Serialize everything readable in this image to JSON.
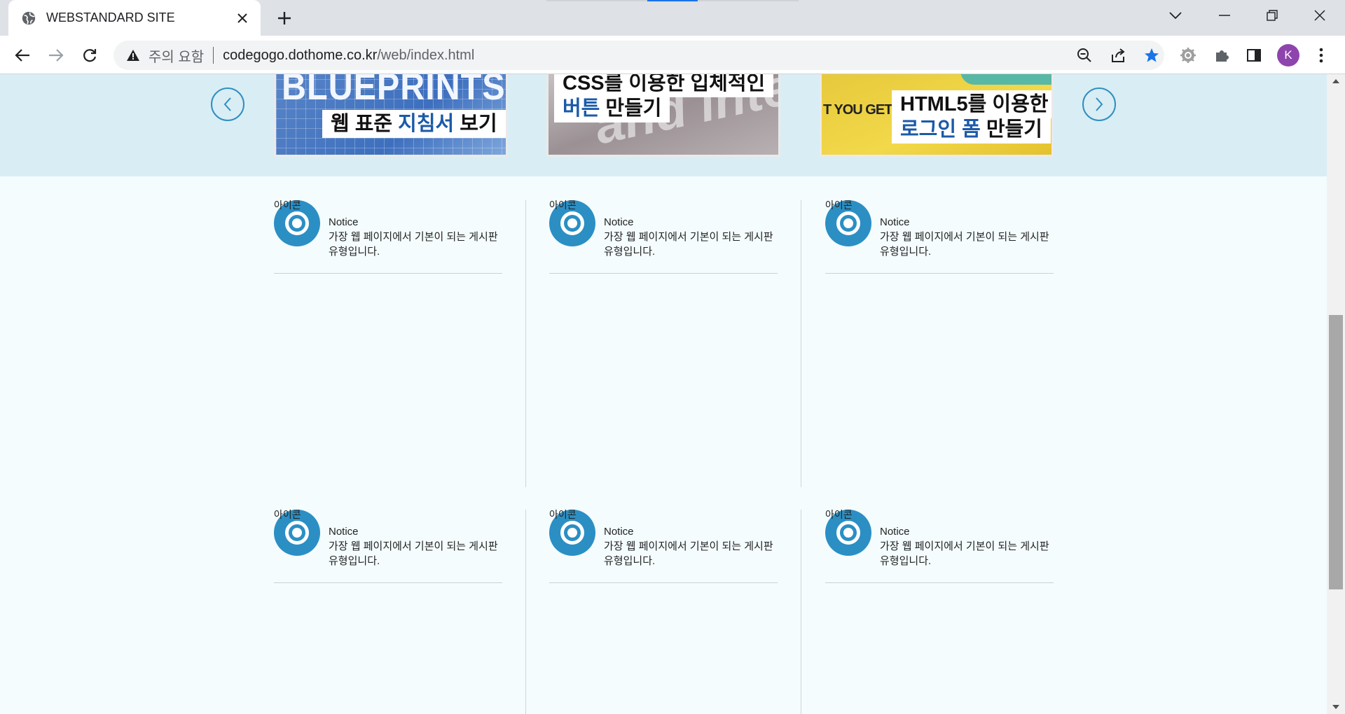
{
  "browser": {
    "tab_title": "WEBSTANDARD SITE",
    "security_label": "주의 요함",
    "url_host": "codegogo.dothome.co.kr",
    "url_path": "/web/index.html",
    "profile_initial": "K"
  },
  "slider": {
    "slides": [
      {
        "big_text": "BLUEPRINTS",
        "caption_pre": "웹 표준 ",
        "caption_hl": "지침서",
        "caption_post": " 보기"
      },
      {
        "line1": "CSS를 이용한 입체적인",
        "line2_hl": "버튼",
        "line2_post": " 만들기",
        "bg_text": "and inte"
      },
      {
        "side_text": "T YOU GET",
        "line1": "HTML5를 이용한",
        "line2_hl": "로그인 폼",
        "line2_post": " 만들기"
      }
    ]
  },
  "boards": [
    {
      "icon_alt": "아이콘",
      "title": "Notice",
      "desc1": "가장 웹 페이지에서 기본이 되는 게시판",
      "desc2": "유형입니다."
    },
    {
      "icon_alt": "아이콘",
      "title": "Notice",
      "desc1": "가장 웹 페이지에서 기본이 되는 게시판",
      "desc2": "유형입니다."
    },
    {
      "icon_alt": "아이콘",
      "title": "Notice",
      "desc1": "가장 웹 페이지에서 기본이 되는 게시판",
      "desc2": "유형입니다."
    },
    {
      "icon_alt": "아이콘",
      "title": "Notice",
      "desc1": "가장 웹 페이지에서 기본이 되는 게시판",
      "desc2": "유형입니다."
    },
    {
      "icon_alt": "아이콘",
      "title": "Notice",
      "desc1": "가장 웹 페이지에서 기본이 되는 게시판",
      "desc2": "유형입니다."
    },
    {
      "icon_alt": "아이콘",
      "title": "Notice",
      "desc1": "가장 웹 페이지에서 기본이 되는 게시판",
      "desc2": "유형입니다."
    }
  ],
  "colors": {
    "accent": "#2b8fc4",
    "slider_bg": "#d9edf5",
    "page_bg": "#f4fcfd",
    "caption_highlight": "#1b5aa8"
  }
}
